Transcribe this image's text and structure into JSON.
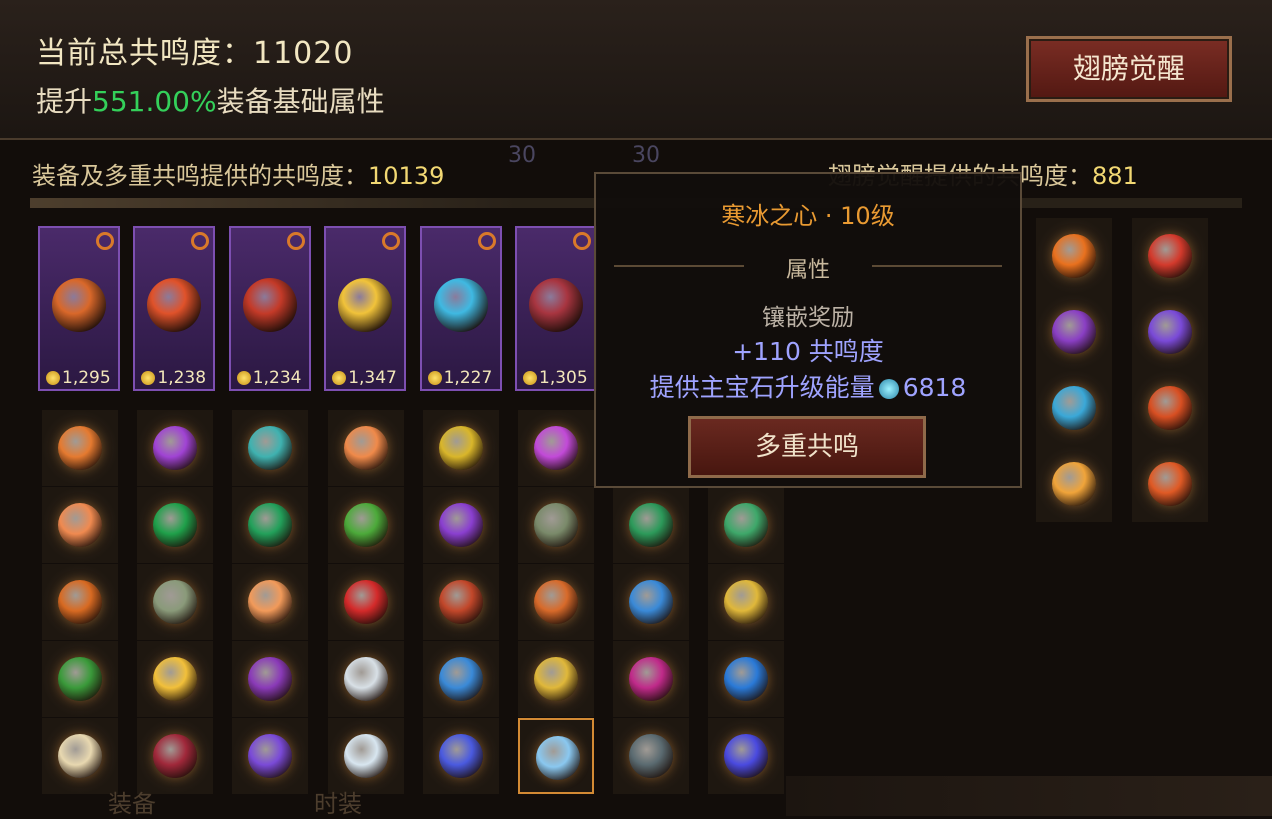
{
  "header": {
    "title_label": "当前总共鸣度：",
    "title_value": "11020",
    "bonus_prefix": "提升",
    "bonus_value": "551.00%",
    "bonus_suffix": "装备基础属性",
    "wing_button_label": "翅膀觉醒"
  },
  "provide": {
    "equipment_label": "装备及多重共鸣提供的共鸣度：",
    "equipment_value": "10139",
    "wing_label": "翅膀觉醒提供的共鸣度：",
    "wing_value": "881"
  },
  "slot_numbers": [
    "30",
    "30"
  ],
  "equipment_cards": [
    {
      "value": "1,295",
      "color": "#d9682a"
    },
    {
      "value": "1,238",
      "color": "#e0522a"
    },
    {
      "value": "1,234",
      "color": "#c43a28"
    },
    {
      "value": "1,347",
      "color": "#f1c33a"
    },
    {
      "value": "1,227",
      "color": "#3fb9e2"
    },
    {
      "value": "1,305",
      "color": "#a83540"
    }
  ],
  "right_gems": [
    "#e9711e",
    "#d33a2c",
    "#8a3fc4",
    "#7a4ad8",
    "#3aa8d8",
    "#d84f22",
    "#f0a43a",
    "#e05a25"
  ],
  "gem_grid": [
    [
      "#e57a30",
      "#a043d4",
      "#3fb2b0",
      "#f08a4a",
      "#d9b62a",
      "#c24ad8"
    ],
    [
      "#f08a50",
      "#1fa04a",
      "#22a05a",
      "#4caa3a",
      "#8a3fd0",
      "#7a8a6a",
      "#2c9a5a",
      "#3ea86a"
    ],
    [
      "#d86a22",
      "#8a9a7a",
      "#f29a5a",
      "#d42a2a",
      "#c2472a",
      "#d86a2a",
      "#3a8ad8",
      "#e0b83a"
    ],
    [
      "#3a9a3a",
      "#f2c03a",
      "#8a3ab8",
      "#d8e0e6",
      "#3a8ad8",
      "#e0b83a",
      "#c02a8a",
      "#2a7ad8"
    ],
    [
      "#e8d8b0",
      "#a0283a",
      "#7a4ad8",
      "#d8e6f0",
      "#4a5ae0",
      "#8ac8f0",
      "#5a6a70",
      "#4a4ae0"
    ]
  ],
  "tooltip": {
    "title": "寒冰之心 · 10级",
    "section": "属性",
    "reward_label": "镶嵌奖励",
    "resonance_bonus": "+110 共鸣度",
    "energy_label": "提供主宝石升级能量",
    "energy_value": "6818",
    "button_label": "多重共鸣"
  },
  "bottom_tabs": [
    "装备",
    "时装"
  ]
}
